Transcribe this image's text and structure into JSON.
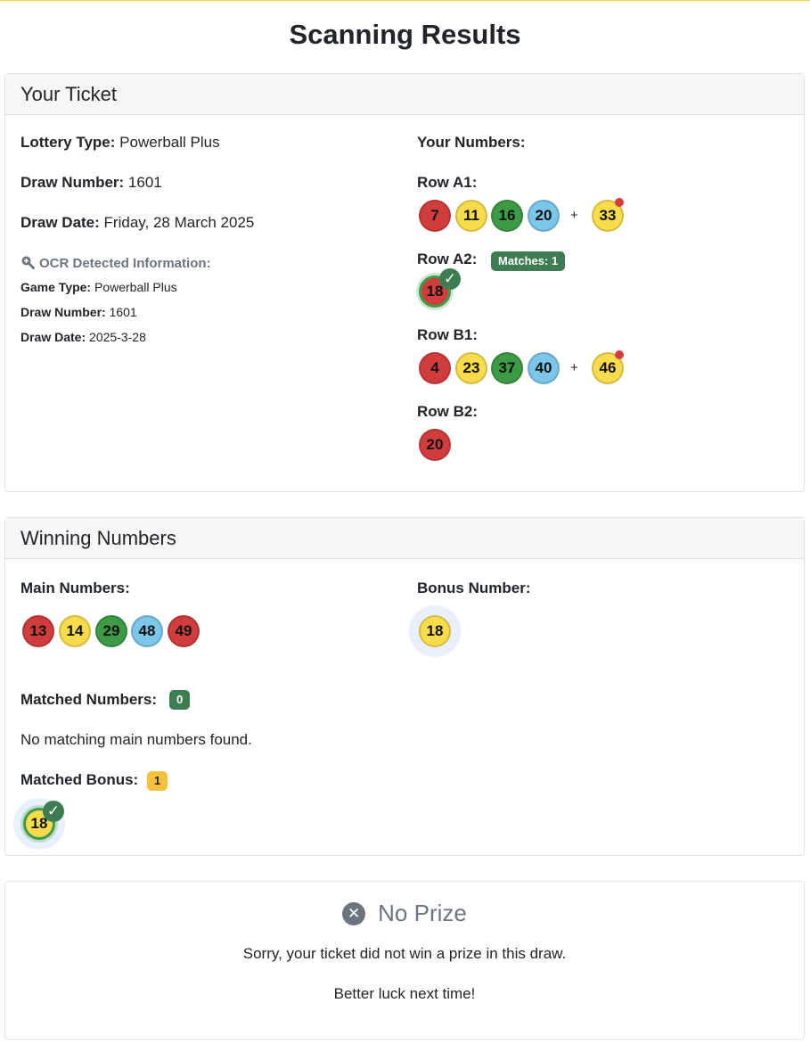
{
  "page_title": "Scanning Results",
  "ticket": {
    "header": "Your Ticket",
    "lottery_type_label": "Lottery Type:",
    "lottery_type_value": "Powerball Plus",
    "draw_number_label": "Draw Number:",
    "draw_number_value": "1601",
    "draw_date_label": "Draw Date:",
    "draw_date_value": "Friday, 28 March 2025",
    "ocr": {
      "icon": "magnify-plus-icon",
      "title": "OCR Detected Information:",
      "game_type_label": "Game Type:",
      "game_type_value": "Powerball Plus",
      "draw_number_label": "Draw Number:",
      "draw_number_value": "1601",
      "draw_date_label": "Draw Date:",
      "draw_date_value": "2025-3-28"
    },
    "your_numbers_label": "Your Numbers:",
    "rows": [
      {
        "label": "Row A1:",
        "numbers": [
          "7",
          "11",
          "16",
          "20"
        ],
        "plus": "+",
        "bonus": "33"
      },
      {
        "label": "Row A2:",
        "matches_badge": "Matches: 1",
        "numbers": [
          "18"
        ]
      },
      {
        "label": "Row B1:",
        "numbers": [
          "4",
          "23",
          "37",
          "40"
        ],
        "plus": "+",
        "bonus": "46"
      },
      {
        "label": "Row B2:",
        "numbers": [
          "20"
        ]
      }
    ]
  },
  "winning": {
    "header": "Winning Numbers",
    "main_label": "Main Numbers:",
    "main_numbers": [
      "13",
      "14",
      "29",
      "48",
      "49"
    ],
    "bonus_label": "Bonus Number:",
    "bonus_number": "18",
    "matched_numbers_label": "Matched Numbers:",
    "matched_numbers_count": "0",
    "no_match_text": "No matching main numbers found.",
    "matched_bonus_label": "Matched Bonus:",
    "matched_bonus_count": "1",
    "matched_bonus_number": "18"
  },
  "result": {
    "icon": "close-circle-icon",
    "title": "No Prize",
    "message": "Sorry, your ticket did not win a prize in this draw.",
    "sub_message": "Better luck next time!"
  },
  "colors": {
    "red": "#d13d3d",
    "yellow": "#f8dc4c",
    "green": "#3d9a45",
    "blue": "#7cc6ea",
    "match_green": "#3e7d52",
    "bonus_badge": "#f7c13d"
  }
}
